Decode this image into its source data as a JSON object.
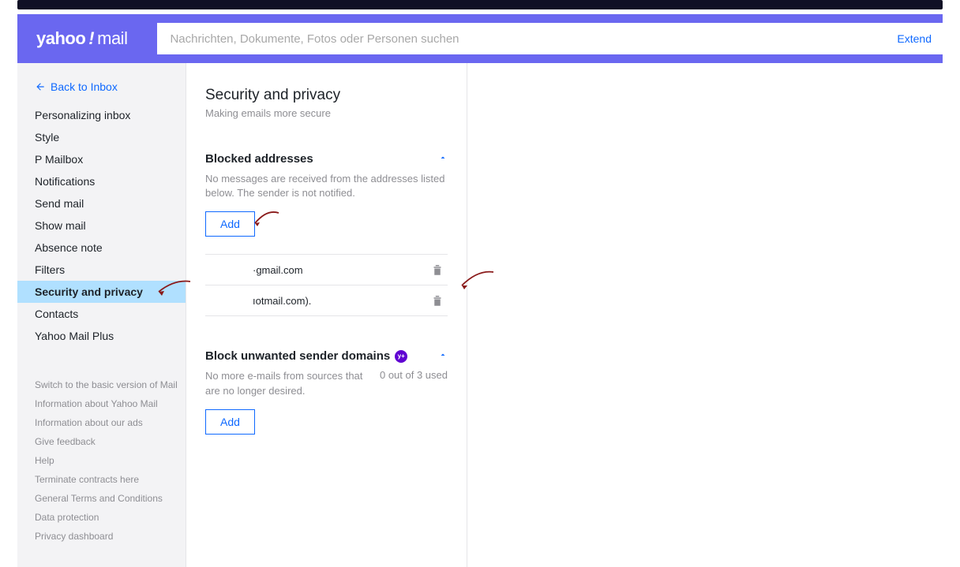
{
  "header": {
    "logo_text_a": "yahoo",
    "logo_text_b": "!",
    "logo_text_c": "mail",
    "search_placeholder": "Nachrichten, Dokumente, Fotos oder Personen suchen",
    "extend_label": "Extend"
  },
  "sidebar": {
    "back_label": "Back to Inbox",
    "items": [
      {
        "label": "Personalizing inbox"
      },
      {
        "label": "Style"
      },
      {
        "label": "P Mailbox"
      },
      {
        "label": "Notifications"
      },
      {
        "label": "Send mail"
      },
      {
        "label": "Show mail"
      },
      {
        "label": "Absence note"
      },
      {
        "label": "Filters"
      },
      {
        "label": "Security and privacy"
      },
      {
        "label": "Contacts"
      },
      {
        "label": "Yahoo Mail Plus"
      }
    ],
    "active_index": 8,
    "secondary": [
      {
        "label": "Switch to the basic version of Mail"
      },
      {
        "label": "Information about Yahoo Mail"
      },
      {
        "label": "Information about our ads"
      },
      {
        "label": "Give feedback"
      },
      {
        "label": "Help"
      },
      {
        "label": "Terminate contracts here"
      },
      {
        "label": "General Terms and Conditions"
      },
      {
        "label": "Data protection"
      },
      {
        "label": "Privacy dashboard"
      }
    ]
  },
  "panel": {
    "title": "Security and privacy",
    "subtitle": "Making emails more secure",
    "blocked": {
      "heading": "Blocked addresses",
      "desc": "No messages are received from the addresses listed below. The sender is not notified.",
      "add_label": "Add",
      "rows": [
        {
          "address": "·gmail.com"
        },
        {
          "address": "ıotmail.com)."
        }
      ]
    },
    "domains": {
      "heading": "Block unwanted sender domains",
      "badge": "y+",
      "desc": "No more e-mails from sources that are no longer desired.",
      "usage": "0 out of 3 used",
      "add_label": "Add"
    }
  }
}
